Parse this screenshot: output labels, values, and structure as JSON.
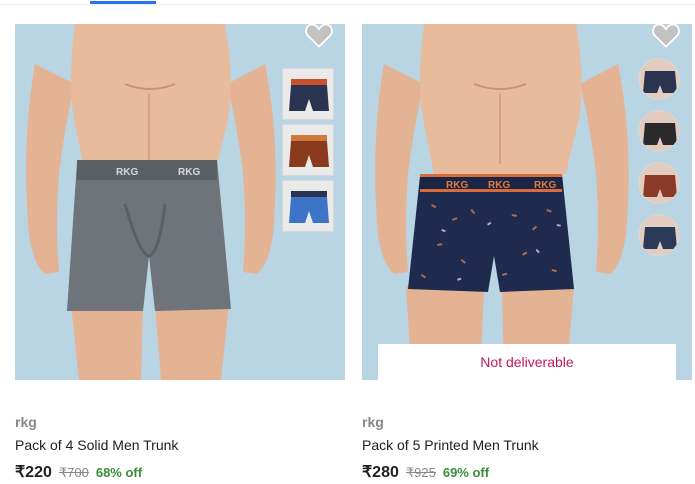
{
  "products": [
    {
      "brand": "rkg",
      "title": "Pack of 4 Solid Men Trunk",
      "price": "₹220",
      "mrp": "₹700",
      "discount": "68% off",
      "waistband_text": "RKG",
      "trunk_color": "#6e747a",
      "thumbnails": [
        {
          "color": "#2a3350",
          "band": "#c8502a"
        },
        {
          "color": "#8a3a1c",
          "band": "#d07a3a"
        },
        {
          "color": "#3e74c8",
          "band": "#2a3350"
        }
      ]
    },
    {
      "brand": "rkg",
      "title": "Pack of 5 Printed Men Trunk",
      "price": "₹280",
      "mrp": "₹925",
      "discount": "69% off",
      "waistband_text": "RKG",
      "trunk_color": "#1e2a4e",
      "delivery_status": "Not deliverable",
      "thumbnails": [
        {
          "color": "#2a3350"
        },
        {
          "color": "#2a2a2a"
        },
        {
          "color": "#8a3a26"
        },
        {
          "color": "#2c3a5a"
        }
      ]
    }
  ],
  "colors": {
    "accent": "#2874f0",
    "discount_green": "#388e3c",
    "not_deliverable": "#c2185b"
  }
}
